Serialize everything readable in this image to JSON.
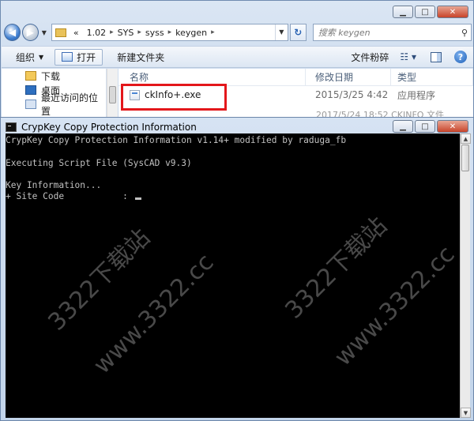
{
  "explorer": {
    "address": {
      "overflow": "«",
      "crumbs": [
        "1.02",
        "SYS",
        "syss",
        "keygen"
      ]
    },
    "search_placeholder": "搜索 keygen",
    "toolbar": {
      "organize_label": "组织",
      "open_label": "打开",
      "new_folder_label": "新建文件夹",
      "burn_label": "文件粉碎"
    },
    "nav_items": [
      {
        "label": "下载",
        "icon": "download-folder-icon"
      },
      {
        "label": "桌面",
        "icon": "desktop-icon"
      },
      {
        "label": "最近访问的位置",
        "icon": "recent-places-icon"
      }
    ],
    "columns": {
      "name": "名称",
      "date": "修改日期",
      "type": "类型"
    },
    "files": [
      {
        "name": "ckInfo+.exe",
        "date": "2015/3/25 4:42",
        "type": "应用程序"
      }
    ],
    "partial_row": "2017/5/24 18:52    CKINFO 文件"
  },
  "console": {
    "title": "CrypKey Copy Protection Information",
    "lines": [
      "CrypKey Copy Protection Information v1.14+ modified by raduga_fb",
      "",
      "Executing Script File (SysCAD v9.3)",
      "",
      "Key Information...",
      "+ Site Code           : "
    ]
  },
  "watermarks": [
    "3322下载站",
    "www.3322.cc",
    "3322下载站",
    "www.3322.cc"
  ]
}
